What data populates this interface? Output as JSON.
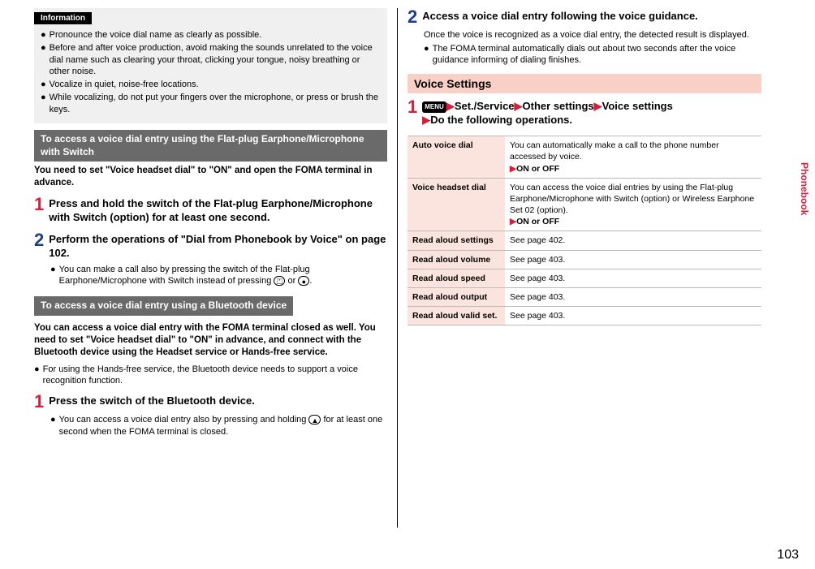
{
  "side_tab": "Phonebook",
  "page_number": "103",
  "left": {
    "info_label": "Information",
    "info_items": [
      "Pronounce the voice dial name as clearly as possible.",
      "Before and after voice production, avoid making the sounds unrelated to the voice dial name such as clearing your throat, clicking your tongue, noisy breathing or other noise.",
      "Vocalize in quiet, noise-free locations.",
      "While vocalizing, do not put your fingers over the microphone, or press or brush the keys."
    ],
    "sub1_title": "To access a voice dial entry using the Flat-plug Earphone/Microphone with Switch",
    "sub1_intro": "You need to set \"Voice headset dial\" to \"ON\" and open the FOMA terminal in advance.",
    "sub1_step1": "Press and hold the switch of the Flat-plug Earphone/Microphone with Switch (option) for at least one second.",
    "sub1_step2": "Perform the operations of \"Dial from Phonebook by Voice\" on page 102.",
    "sub1_step2_body_a": "You can make a call also by pressing the switch of the Flat-plug Earphone/Microphone with Switch instead of pressing ",
    "sub1_step2_body_b": " or ",
    "sub2_title": "To access a voice dial entry using a Bluetooth device",
    "sub2_intro": "You can access a voice dial entry with the FOMA terminal closed as well. You need to set \"Voice headset dial\" to \"ON\" in advance, and connect with the Bluetooth device using the Headset service or Hands-free service.",
    "sub2_note": "For using the Hands-free service, the Bluetooth device needs to support a voice recognition function.",
    "sub2_step1": "Press the switch of the Bluetooth device.",
    "sub2_step1_body_a": "You can access a voice dial entry also by pressing and holding ",
    "sub2_step1_body_b": " for at least one second when the FOMA terminal is closed."
  },
  "right": {
    "step2_title": "Access a voice dial entry following the voice guidance.",
    "step2_body1": "Once the voice is recognized as a voice dial entry, the detected result is displayed.",
    "step2_body2": "The FOMA terminal automatically dials out about two seconds after the voice guidance informing of dialing finishes.",
    "section_title": "Voice Settings",
    "nav_menu_label": "MENU",
    "nav_a": "Set./Service",
    "nav_b": "Other settings",
    "nav_c": "Voice settings",
    "nav_d": "Do the following operations.",
    "table": [
      {
        "label": "Auto voice dial",
        "desc_a": "You can automatically make a call to the phone number accessed by voice.",
        "opt": "ON or OFF"
      },
      {
        "label": "Voice headset dial",
        "desc_a": "You can access the voice dial entries by using the Flat-plug Earphone/Microphone with Switch (option) or Wireless Earphone Set 02 (option).",
        "opt": "ON or OFF"
      },
      {
        "label": "Read aloud settings",
        "desc_a": "See page 402."
      },
      {
        "label": "Read aloud volume",
        "desc_a": "See page 403."
      },
      {
        "label": "Read aloud speed",
        "desc_a": "See page 403."
      },
      {
        "label": "Read aloud output",
        "desc_a": "See page 403."
      },
      {
        "label": "Read aloud valid set.",
        "desc_a": "See page 403."
      }
    ]
  }
}
